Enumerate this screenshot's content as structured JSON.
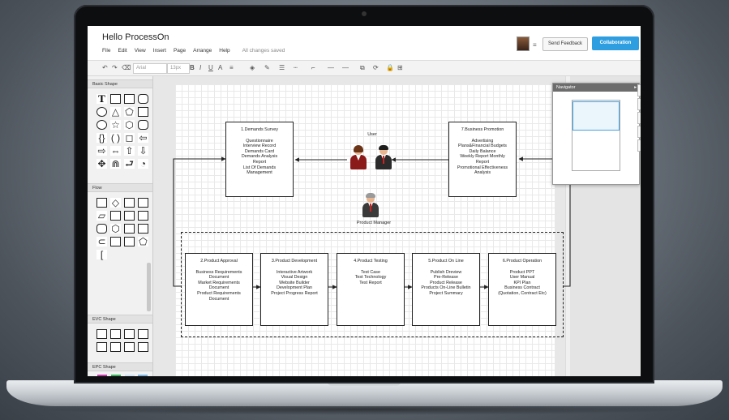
{
  "app": {
    "title": "Hello ProcessOn",
    "menu": [
      "File",
      "Edit",
      "View",
      "Insert",
      "Page",
      "Arrange",
      "Help"
    ],
    "status": "All changes saved",
    "send_feedback": "Send Feedback",
    "collaboration": "Collaboration"
  },
  "toolbar": {
    "font": "Arial",
    "size": "13px"
  },
  "sidebar": {
    "sections": [
      "Basic Shape",
      "Flow",
      "EVC Shape",
      "EPC Shape"
    ]
  },
  "navigator": {
    "title": "Navigator"
  },
  "diagram": {
    "user_label": "User",
    "manager_label": "Product Manager",
    "nodes": [
      {
        "title": "1.Demands Survey",
        "body": "Questionnaire\nInterview Record\nDemands Card\nDemands Analysis\nReport\nList Of Demands\nManagement"
      },
      {
        "title": "7.Business Promotion",
        "body": "Advertising\nPlans&Financial Budgets\nDaily Balance\nWeekly Report Monthly\nReport\nPromotional Effectiveness\nAnalysis"
      },
      {
        "title": "2.Product Approval",
        "body": "Business Requirements\nDocument\nMarket Requirements\nDocument\nProduct Requirements\nDocument"
      },
      {
        "title": "3.Product Development",
        "body": "Interactive Artwork\nVisual Design\nWebsite Builder\nDevelopment Plan\nProject Progress Report"
      },
      {
        "title": "4.Product Testing",
        "body": "Test Case\nTest Technology\nTest Report"
      },
      {
        "title": "5.Product On Line",
        "body": "Publish Dreview\nPre-Release\nProduct Release\nProducts On-Line Bulletin\nProject Summary"
      },
      {
        "title": "6.Product Operation",
        "body": "Product PPT\nUser Manual\nKPI Plan\nBusiness Contract\n(Quotation, Contract Etc)"
      }
    ]
  }
}
